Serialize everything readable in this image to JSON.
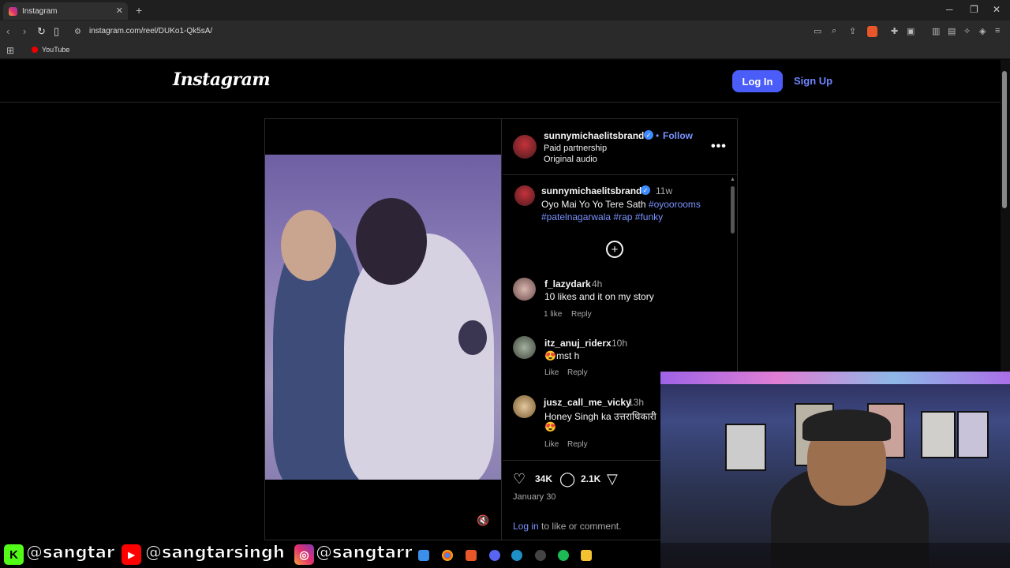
{
  "browser": {
    "tab_title": "Instagram",
    "tab_close": "✕",
    "new_tab": "+",
    "win_minimize": "─",
    "win_restore": "❐",
    "win_close": "✕",
    "url": "instagram.com/reel/DUKo1-Qk5sA/",
    "bookmark_youtube": "YouTube"
  },
  "header": {
    "logo": "Instagram",
    "login_label": "Log In",
    "signup_label": "Sign Up"
  },
  "post": {
    "author": "sunnymichaelitsbrand",
    "separator": "•",
    "follow_label": "Follow",
    "paid_partnership": "Paid partnership",
    "audio": "Original audio",
    "caption_author": "sunnymichaelitsbrand",
    "caption_time": "11w",
    "caption_text": "Oyo Mai Yo Yo Tere Sath ",
    "caption_tag1": "#oyoorooms",
    "caption_tag2": "#patelnagarwala",
    "caption_tag3": "#rap",
    "caption_tag4": "#funky"
  },
  "comments": [
    {
      "user": "f_lazydark",
      "time": "4h",
      "text": "10 likes and it on my story",
      "likes": "1 like",
      "reply": "Reply"
    },
    {
      "user": "itz_anuj_riderx",
      "time": "10h",
      "text": "😍mst h",
      "likes": "Like",
      "reply": "Reply"
    },
    {
      "user": "jusz_call_me_vicky",
      "time": "13h",
      "text": "Honey Singh ka उत्तराधिकारी",
      "emoji": "😍",
      "likes": "Like",
      "reply": "Reply"
    }
  ],
  "actions": {
    "likes_count": "34K",
    "comments_count": "2.1K",
    "date": "January 30",
    "login_link": "Log in",
    "login_suffix": " to like or comment."
  },
  "overlay": {
    "kick_handle": "@sangtar",
    "youtube_handle": "@sangtarsingh",
    "instagram_handle": "@sangtarr"
  },
  "colors": {
    "accent": "#4a5df9",
    "link": "#7a93ff",
    "verified": "#3d8bff"
  }
}
